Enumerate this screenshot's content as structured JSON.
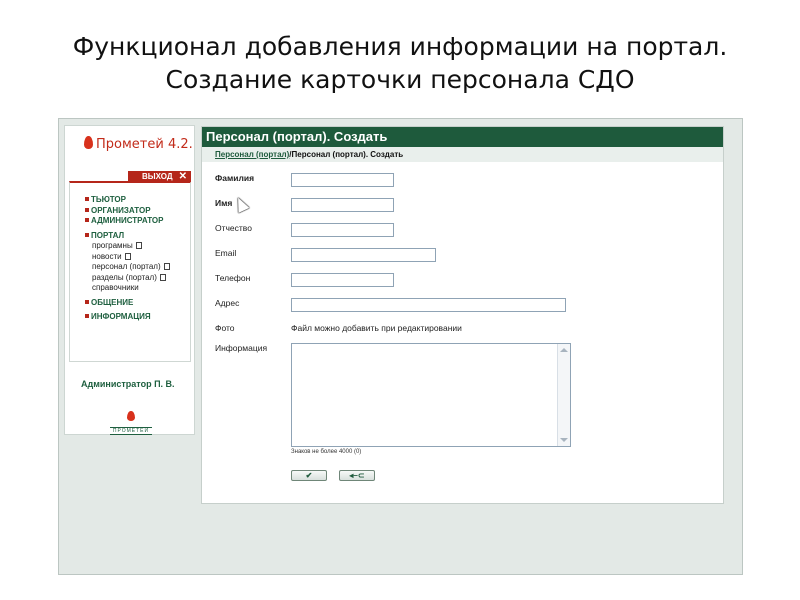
{
  "slide": {
    "title_line1": "Функционал добавления информации на портал.",
    "title_line2": "Создание карточки персонала СДО"
  },
  "sidebar": {
    "logo_text": "Прометей 4.2.",
    "logout_label": "ВЫХОД",
    "logout_icon": "close-icon",
    "menu": {
      "tutor": "ТЬЮТОР",
      "organizer": "ОРГАНИЗАТОР",
      "administrator": "АДМИНИСТРАТОР",
      "portal": "ПОРТАЛ",
      "portal_items": {
        "programs": "програмны",
        "news": "новости",
        "staff": "персонал (портал)",
        "sections": "разделы (портал)",
        "references": "справочники"
      },
      "communication": "ОБЩЕНИЕ",
      "information": "ИНФОРМАЦИЯ"
    },
    "user_name": "Администратор П. В.",
    "bottom_logo_text": "ПРОМЕТЕЙ"
  },
  "main": {
    "header": "Персонал (портал). Создать",
    "breadcrumb": {
      "link": "Персонал (портал)",
      "separator": "/",
      "current": "Персонал (портал). Создать"
    },
    "form": {
      "surname_label": "Фамилия",
      "name_label": "Имя",
      "patronymic_label": "Отчество",
      "email_label": "Email",
      "phone_label": "Телефон",
      "address_label": "Адрес",
      "photo_label": "Фото",
      "photo_note": "Файл можно добавить при редактировании",
      "info_label": "Информация",
      "info_limit": "Знаков не более 4000 (0)",
      "surname_value": "",
      "name_value": "",
      "patronymic_value": "",
      "email_value": "",
      "phone_value": "",
      "address_value": "",
      "info_value": ""
    },
    "buttons": {
      "submit_icon": "check-icon",
      "back_icon": "back-arrow-icon",
      "submit_glyph": "✔",
      "back_glyph": "◂–⊂"
    }
  }
}
